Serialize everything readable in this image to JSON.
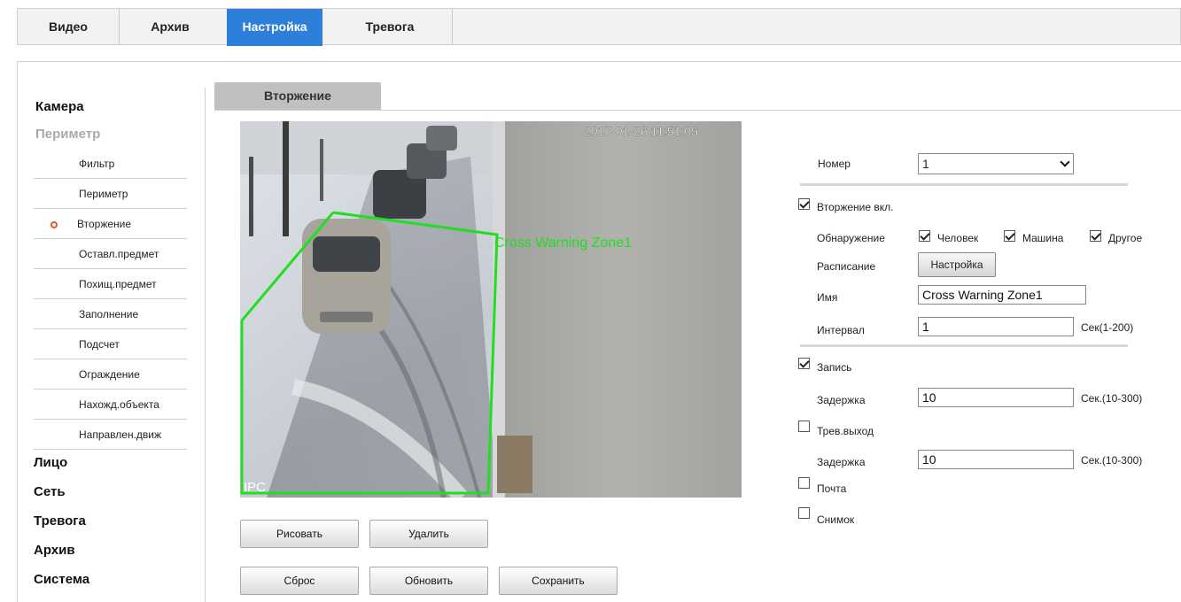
{
  "nav": {
    "tabs": [
      {
        "label": "Видео"
      },
      {
        "label": "Архив"
      },
      {
        "label": "Настройка"
      },
      {
        "label": "Тревога"
      }
    ]
  },
  "sidebar": {
    "camera": "Камера",
    "perimeter": "Периметр",
    "sub": [
      {
        "label": "Фильтр"
      },
      {
        "label": "Периметр"
      },
      {
        "label": "Вторжение"
      },
      {
        "label": "Оставл.предмет"
      },
      {
        "label": "Похищ.предмет"
      },
      {
        "label": "Заполнение"
      },
      {
        "label": "Подсчет"
      },
      {
        "label": "Ограждение"
      },
      {
        "label": "Нахожд.объекта"
      },
      {
        "label": "Направлен.движ"
      }
    ],
    "bottom": [
      {
        "label": "Лицо"
      },
      {
        "label": "Сеть"
      },
      {
        "label": "Тревога"
      },
      {
        "label": "Архив"
      },
      {
        "label": "Система"
      }
    ]
  },
  "section": {
    "title": "Вторжение"
  },
  "video": {
    "timestamp": "2017-01-26 11:51:05",
    "zone_label": "Cross Warning Zone1",
    "osd_label": "IPC"
  },
  "buttons": {
    "draw": "Рисовать",
    "delete": "Удалить",
    "reset": "Сброс",
    "refresh": "Обновить",
    "save": "Сохранить"
  },
  "form": {
    "number_label": "Номер",
    "number_value": "1",
    "intrusion_enable": {
      "label": "Вторжение вкл.",
      "checked": true
    },
    "detection_label": "Обнаружение",
    "detection": [
      {
        "label": "Человек",
        "checked": true
      },
      {
        "label": "Машина",
        "checked": true
      },
      {
        "label": "Другое",
        "checked": true
      }
    ],
    "schedule_label": "Расписание",
    "schedule_button": "Настройка",
    "name_label": "Имя",
    "name_value": "Cross Warning Zone1",
    "interval_label": "Интервал",
    "interval_value": "1",
    "interval_unit": "Сек(1-200)",
    "record": {
      "label": "Запись",
      "checked": true
    },
    "record_delay_label": "Задержка",
    "record_delay_value": "10",
    "record_delay_unit": "Сек.(10-300)",
    "alarm_out": {
      "label": "Трев.выход",
      "checked": false
    },
    "alarm_delay_label": "Задержка",
    "alarm_delay_value": "10",
    "alarm_delay_unit": "Сек.(10-300)",
    "mail": {
      "label": "Почта",
      "checked": false
    },
    "snapshot": {
      "label": "Снимок",
      "checked": false
    }
  },
  "colors": {
    "active_tab": "#2d7fd9",
    "sub_link": "#8a13b8",
    "zone_line": "#22dd22",
    "active_dot": "#e05a1d"
  }
}
